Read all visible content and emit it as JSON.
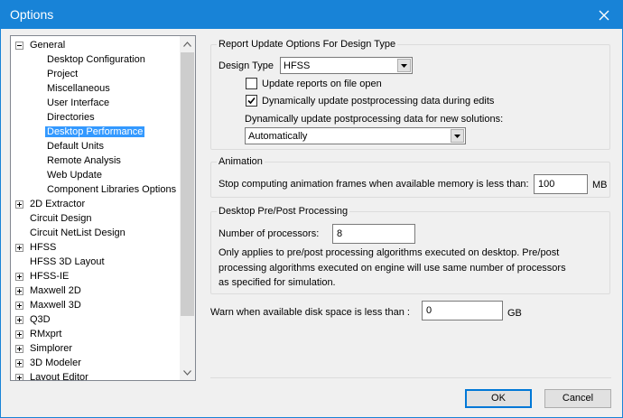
{
  "window": {
    "title": "Options",
    "close_icon": "close-icon"
  },
  "tree": {
    "items": [
      {
        "label": "General",
        "level": 0,
        "expander": "minus"
      },
      {
        "label": "Desktop Configuration",
        "level": 1
      },
      {
        "label": "Project",
        "level": 1
      },
      {
        "label": "Miscellaneous",
        "level": 1
      },
      {
        "label": "User Interface",
        "level": 1
      },
      {
        "label": "Directories",
        "level": 1
      },
      {
        "label": "Desktop Performance",
        "level": 1,
        "selected": true
      },
      {
        "label": "Default Units",
        "level": 1
      },
      {
        "label": "Remote Analysis",
        "level": 1
      },
      {
        "label": "Web Update",
        "level": 1
      },
      {
        "label": "Component Libraries Options",
        "level": 1
      },
      {
        "label": "2D Extractor",
        "level": 0,
        "expander": "plus"
      },
      {
        "label": "Circuit Design",
        "level": 0
      },
      {
        "label": "Circuit NetList Design",
        "level": 0
      },
      {
        "label": "HFSS",
        "level": 0,
        "expander": "plus"
      },
      {
        "label": "HFSS 3D Layout",
        "level": 0
      },
      {
        "label": "HFSS-IE",
        "level": 0,
        "expander": "plus"
      },
      {
        "label": "Maxwell 2D",
        "level": 0,
        "expander": "plus"
      },
      {
        "label": "Maxwell 3D",
        "level": 0,
        "expander": "plus"
      },
      {
        "label": "Q3D",
        "level": 0,
        "expander": "plus"
      },
      {
        "label": "RMxprt",
        "level": 0,
        "expander": "plus"
      },
      {
        "label": "Simplorer",
        "level": 0,
        "expander": "plus"
      },
      {
        "label": "3D Modeler",
        "level": 0,
        "expander": "plus"
      },
      {
        "label": "Layout Editor",
        "level": 0,
        "expander": "plus"
      }
    ]
  },
  "report_update": {
    "title": "Report Update Options For Design Type",
    "design_type_label": "Design Type",
    "design_type_value": "HFSS",
    "update_on_open_label": "Update reports on file open",
    "update_on_open_checked": false,
    "dynamic_update_label": "Dynamically update postprocessing data during edits",
    "dynamic_update_checked": true,
    "new_solutions_label": "Dynamically update postprocessing data for new solutions:",
    "new_solutions_value": "Automatically"
  },
  "animation": {
    "title": "Animation",
    "label": "Stop computing animation frames when available memory is less than:",
    "value": "100",
    "unit": "MB"
  },
  "prepost": {
    "title": "Desktop Pre/Post Processing",
    "processors_label": "Number of processors:",
    "processors_value": "8",
    "note_line1": "Only applies to pre/post processing algorithms executed on desktop. Pre/post",
    "note_line2": "processing algorithms executed on engine will use same number of processors",
    "note_line3": "as specified for simulation."
  },
  "disk": {
    "label": "Warn when available disk space is less than :",
    "value": "0",
    "unit": "GB"
  },
  "buttons": {
    "ok": "OK",
    "cancel": "Cancel"
  },
  "colors": {
    "titlebar": "#1883d7",
    "selection": "#3399ff"
  }
}
